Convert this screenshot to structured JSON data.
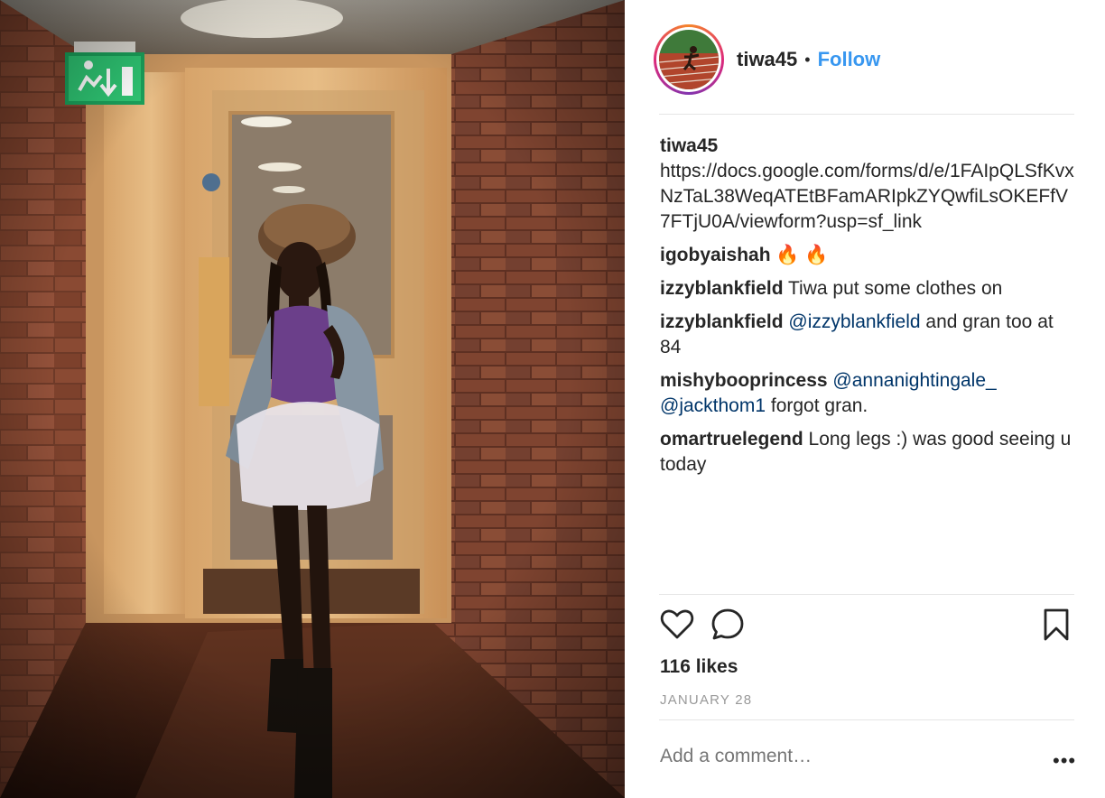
{
  "post": {
    "author": "tiwa45",
    "follow_label": "Follow",
    "separator": "•",
    "likes": "116 likes",
    "date": "JANUARY 28",
    "add_comment_placeholder": "Add a comment…",
    "more_label": "•••"
  },
  "comments": [
    {
      "user": "tiwa45",
      "parts": [
        {
          "type": "text",
          "value": "https://docs.google.com/forms/d/e/1FAIpQLSfKvxNzTaL38WeqATEtBFamARIpkZYQwfiLsOKEFfV7FTjU0A/viewform?usp=sf_link"
        }
      ]
    },
    {
      "user": "igobyaishah",
      "parts": [
        {
          "type": "text",
          "value": "🔥 🔥"
        }
      ]
    },
    {
      "user": "izzyblankfield",
      "parts": [
        {
          "type": "text",
          "value": "Tiwa put some clothes on"
        }
      ]
    },
    {
      "user": "izzyblankfield",
      "parts": [
        {
          "type": "mention",
          "value": "@izzyblankfield"
        },
        {
          "type": "text",
          "value": " and gran too at 84"
        }
      ]
    },
    {
      "user": "mishybooprincess",
      "parts": [
        {
          "type": "mention",
          "value": "@annanightingale_"
        },
        {
          "type": "text",
          "value": " "
        },
        {
          "type": "mention",
          "value": "@jackthom1"
        },
        {
          "type": "text",
          "value": " forgot gran."
        }
      ]
    },
    {
      "user": "omartruelegend",
      "parts": [
        {
          "type": "text",
          "value": "Long legs :) was good seeing u today"
        }
      ]
    }
  ],
  "icons": {
    "like": "heart-icon",
    "comment": "comment-bubble-icon",
    "save": "bookmark-icon",
    "exit_sign": "emergency-exit-sign"
  },
  "colors": {
    "follow": "#3897f0",
    "mention": "#003569",
    "muted": "#999999",
    "text": "#262626"
  }
}
